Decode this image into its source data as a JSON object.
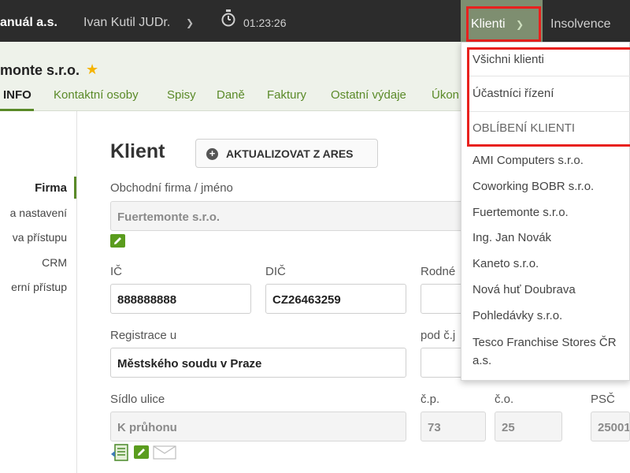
{
  "topbar": {
    "company": "anuál a.s.",
    "user": "Ivan Kutil JUDr.",
    "timer": "01:23:26",
    "menu_klienti": "Klienti",
    "menu_insolvence": "Insolvence"
  },
  "header": {
    "title": "monte s.r.o.",
    "tabs": [
      "INFO",
      "Kontaktní osoby",
      "Spisy",
      "Daně",
      "Faktury",
      "Ostatní výdaje",
      "Úkon"
    ]
  },
  "sidebar": {
    "items": [
      "Firma",
      "a nastavení",
      "va přístupu",
      "CRM",
      "erní přístup"
    ]
  },
  "main": {
    "title": "Klient",
    "ares_button": "AKTUALIZOVAT Z ARES",
    "labels": {
      "firm": "Obchodní firma / jméno",
      "ic": "IČ",
      "dic": "DIČ",
      "rodne": "Rodné",
      "registrace": "Registrace u",
      "pod_cj": "pod č.j",
      "sidlo": "Sídlo ulice",
      "cp": "č.p.",
      "co": "č.o.",
      "psc": "PSČ"
    },
    "values": {
      "firm": "Fuertemonte s.r.o.",
      "ic": "888888888",
      "dic": "CZ26463259",
      "registrace": "Městského soudu v Praze",
      "sidlo": "K průhonu",
      "cp": "73",
      "co": "25",
      "psc": "25001"
    }
  },
  "dropdown": {
    "items": [
      "Všichni klienti",
      "Účastníci řízení",
      "OBLÍBENÍ KLIENTI"
    ],
    "clients": [
      "AMI Computers s.r.o.",
      "Coworking BOBR s.r.o.",
      "Fuertemonte s.r.o.",
      "Ing. Jan Novák",
      "Kaneto s.r.o.",
      "Nová huť Doubrava",
      "Pohledávky s.r.o.",
      "Tesco Franchise Stores ČR",
      "a.s."
    ]
  },
  "colors": {
    "topbar": "#2c2c2c",
    "accent_green": "#5a8a28",
    "active_menu": "#7e8e70",
    "highlight_red": "#e8211e"
  }
}
